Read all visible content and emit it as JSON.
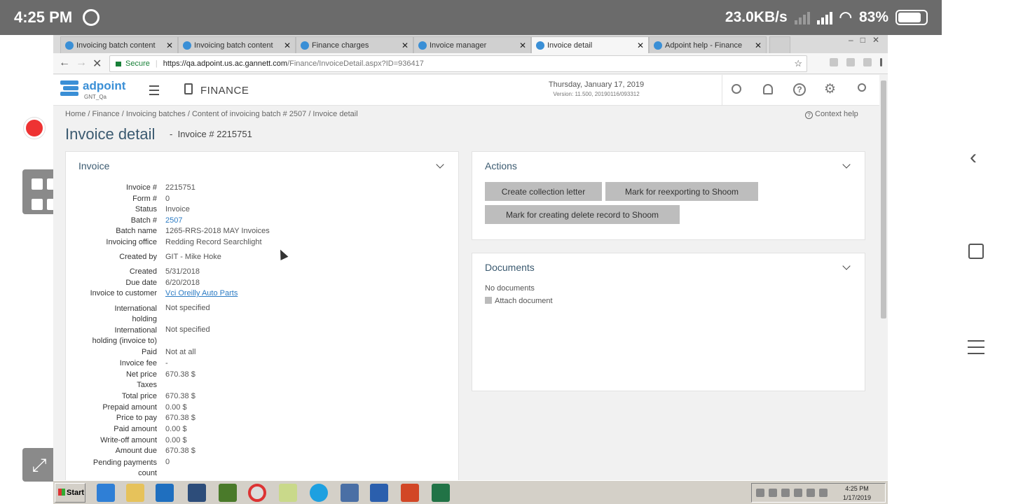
{
  "status_bar": {
    "time": "4:25 PM",
    "speed": "23.0KB/s",
    "battery": "83%"
  },
  "tabs": [
    {
      "label": "Invoicing batch content"
    },
    {
      "label": "Invoicing batch content"
    },
    {
      "label": "Finance charges"
    },
    {
      "label": "Invoice manager"
    },
    {
      "label": "Invoice detail"
    },
    {
      "label": "Adpoint help - Finance"
    }
  ],
  "address": {
    "secure_label": "Secure",
    "url_host": "https://qa.adpoint.us.ac.gannett.com",
    "url_path": "/Finance/InvoiceDetail.aspx?ID=936417"
  },
  "header": {
    "logo": "adpoint",
    "logo_sub": "GNT_Qa",
    "module": "FINANCE",
    "date": "Thursday, January 17, 2019",
    "version": "Version: 11.500, 20190116/093312"
  },
  "breadcrumb": "Home / Finance / Invoicing batches / Content of invoicing batch # 2507 / Invoice detail",
  "context_help": "Context help",
  "page": {
    "title": "Invoice detail",
    "dash": "-",
    "subtitle": "Invoice # 2215751"
  },
  "invoice_panel": {
    "title": "Invoice",
    "fields": [
      {
        "label": "Invoice #",
        "value": "2215751"
      },
      {
        "label": "Form #",
        "value": "0"
      },
      {
        "label": "Status",
        "value": "Invoice"
      },
      {
        "label": "Batch #",
        "value": "2507"
      },
      {
        "label": "Batch name",
        "value": "1265-RRS-2018 MAY Invoices"
      },
      {
        "label": "Invoicing office",
        "value": "Redding Record Searchlight"
      },
      {
        "label": "Created by",
        "value": "GIT - Mike Hoke"
      },
      {
        "label": "Created",
        "value": "5/31/2018"
      },
      {
        "label": "Due date",
        "value": "6/20/2018"
      },
      {
        "label": "Invoice to customer",
        "value": "Vci Oreilly Auto Parts"
      },
      {
        "label": "International",
        "label2": "holding",
        "value": "Not specified"
      },
      {
        "label": "International",
        "label2": "holding (invoice to)",
        "value": "Not specified"
      },
      {
        "label": "Paid",
        "value": "Not at all"
      },
      {
        "label": "Invoice fee",
        "value": "-"
      },
      {
        "label": "Net price",
        "value": "670.38 $"
      },
      {
        "label": "Taxes",
        "value": ""
      },
      {
        "label": "Total price",
        "value": "670.38 $"
      },
      {
        "label": "Prepaid amount",
        "value": "0.00 $"
      },
      {
        "label": "Price to pay",
        "value": "670.38 $"
      },
      {
        "label": "Paid amount",
        "value": "0.00 $"
      },
      {
        "label": "Write-off amount",
        "value": "0.00 $"
      },
      {
        "label": "Amount due",
        "value": "670.38 $"
      },
      {
        "label": "Pending payments",
        "label2": "count",
        "value": "0"
      }
    ]
  },
  "actions_panel": {
    "title": "Actions",
    "buttons": [
      {
        "label": "Create collection letter"
      },
      {
        "label": "Mark for reexporting to Shoom"
      },
      {
        "label": "Mark for creating delete record to Shoom"
      }
    ]
  },
  "documents_panel": {
    "title": "Documents",
    "empty_text": "No documents",
    "attach_label": "Attach document"
  },
  "taskbar": {
    "start_label": "Start",
    "time": "4:25 PM",
    "date": "1/17/2019"
  }
}
